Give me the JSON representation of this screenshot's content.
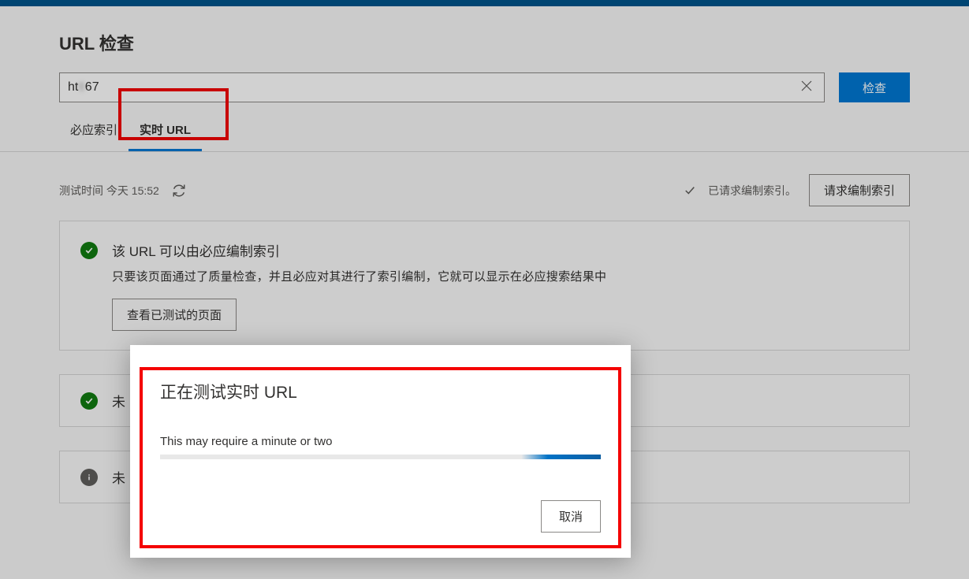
{
  "header": {
    "title": "URL 检查"
  },
  "search": {
    "prefix": "ht",
    "blurred": "t                                        ",
    "suffix": "67",
    "inspect_label": "检查"
  },
  "tabs": {
    "bing_index": "必应索引",
    "live_url": "实时 URL"
  },
  "status_row": {
    "test_time": "测试时间 今天 15:52",
    "indexed_text": "已请求编制索引。",
    "request_index_btn": "请求编制索引"
  },
  "card1": {
    "title": "该 URL 可以由必应编制索引",
    "desc": "只要该页面通过了质量检查，并且必应对其进行了索引编制，它就可以显示在必应搜索结果中",
    "btn": "查看已测试的页面"
  },
  "card2": {
    "title_prefix": "未"
  },
  "card3": {
    "title_prefix": "未"
  },
  "modal": {
    "title": "正在测试实时 URL",
    "message": "This may require a minute or two",
    "cancel": "取消"
  }
}
